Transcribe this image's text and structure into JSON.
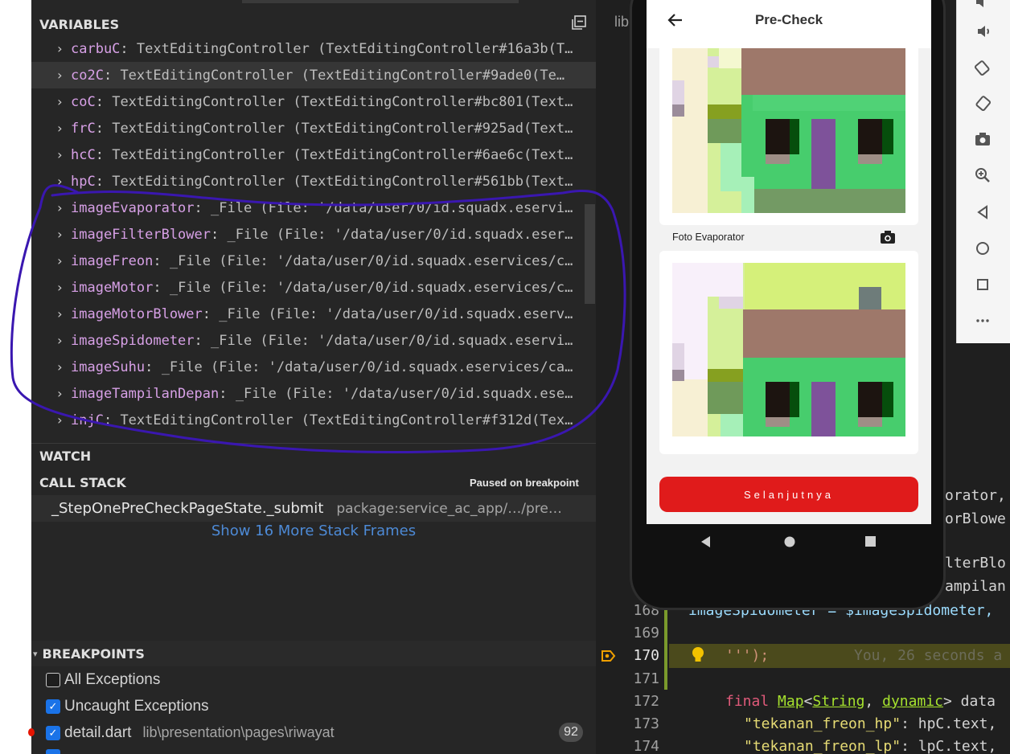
{
  "debug": {
    "variables_header": "VARIABLES",
    "variables": [
      {
        "name": "carbuC",
        "value": "TextEditingController (TextEditingController#16a3b(T…"
      },
      {
        "name": "co2C",
        "value": "TextEditingController (TextEditingController#9ade0(Te…"
      },
      {
        "name": "coC",
        "value": "TextEditingController (TextEditingController#bc801(Text…"
      },
      {
        "name": "frC",
        "value": "TextEditingController (TextEditingController#925ad(Text…"
      },
      {
        "name": "hcC",
        "value": "TextEditingController (TextEditingController#6ae6c(Text…"
      },
      {
        "name": "hpC",
        "value": "TextEditingController (TextEditingController#561bb(Text…"
      },
      {
        "name": "imageEvaporator",
        "value": "_File (File: '/data/user/0/id.squadx.eservi…"
      },
      {
        "name": "imageFilterBlower",
        "value": "_File (File: '/data/user/0/id.squadx.eser…"
      },
      {
        "name": "imageFreon",
        "value": "_File (File: '/data/user/0/id.squadx.eservices/c…"
      },
      {
        "name": "imageMotor",
        "value": "_File (File: '/data/user/0/id.squadx.eservices/c…"
      },
      {
        "name": "imageMotorBlower",
        "value": "_File (File: '/data/user/0/id.squadx.eserv…"
      },
      {
        "name": "imageSpidometer",
        "value": "_File (File: '/data/user/0/id.squadx.eservi…"
      },
      {
        "name": "imageSuhu",
        "value": "_File (File: '/data/user/0/id.squadx.eservices/ca…"
      },
      {
        "name": "imageTampilanDepan",
        "value": "_File (File: '/data/user/0/id.squadx.ese…"
      },
      {
        "name": "injC",
        "value": "TextEditingController (TextEditingController#f312d(Tex…"
      }
    ],
    "watch_header": "WATCH",
    "callstack_header": "CALL STACK",
    "callstack_status": "Paused on breakpoint",
    "stack_frame_name": "_StepOnePreCheckPageState._submit",
    "stack_frame_path": "package:service_ac_app/…/pre…",
    "show_more_frames": "Show 16 More Stack Frames",
    "breakpoints_header": "BREAKPOINTS",
    "breakpoints": [
      {
        "label": "All Exceptions",
        "checked": false
      },
      {
        "label": "Uncaught Exceptions",
        "checked": true
      },
      {
        "label": "detail.dart",
        "path": "lib\\presentation\\pages\\riwayat",
        "line": "92",
        "checked": true
      }
    ]
  },
  "editor": {
    "tab_partial": "lib",
    "line_numbers": [
      "168",
      "169",
      "170",
      "171",
      "172",
      "173",
      "174"
    ],
    "hidden_line_number": "1",
    "peek_lines": [
      "orator,",
      "orBlowe",
      "lterBlo",
      "ampilan"
    ],
    "line_168": "imageSpidometer = $imageSpidometer,",
    "line_170_code": "''');",
    "line_170_blame": "You, 26 seconds a",
    "line_172": {
      "keyword": "final",
      "type": "Map",
      "lt": "<",
      "t1": "String",
      "comma": ", ",
      "t2": "dynamic",
      "gt": ">",
      "rest": " data"
    },
    "line_173": {
      "key": "\"tekanan_freon_hp\"",
      "rest": ": hpC.text,"
    },
    "line_174": {
      "key": "\"tekanan_freon_lp\"",
      "rest": ": lpC.text,"
    }
  },
  "app": {
    "title": "Pre-Check",
    "photo_label": "Foto Evaporator",
    "next_button": "Selanjutnya"
  },
  "emulator_toolbar": [
    "volume-up-icon",
    "volume-down-icon",
    "rotate-left-icon",
    "rotate-right-icon",
    "camera-icon",
    "zoom-icon",
    "back-icon",
    "home-icon",
    "overview-icon",
    "more-icon"
  ],
  "colors": {
    "var_name": "#d7a0e6",
    "highlight_circle": "#3a17b0",
    "next_button": "#e01b1b",
    "checkbox": "#1a73e8"
  }
}
